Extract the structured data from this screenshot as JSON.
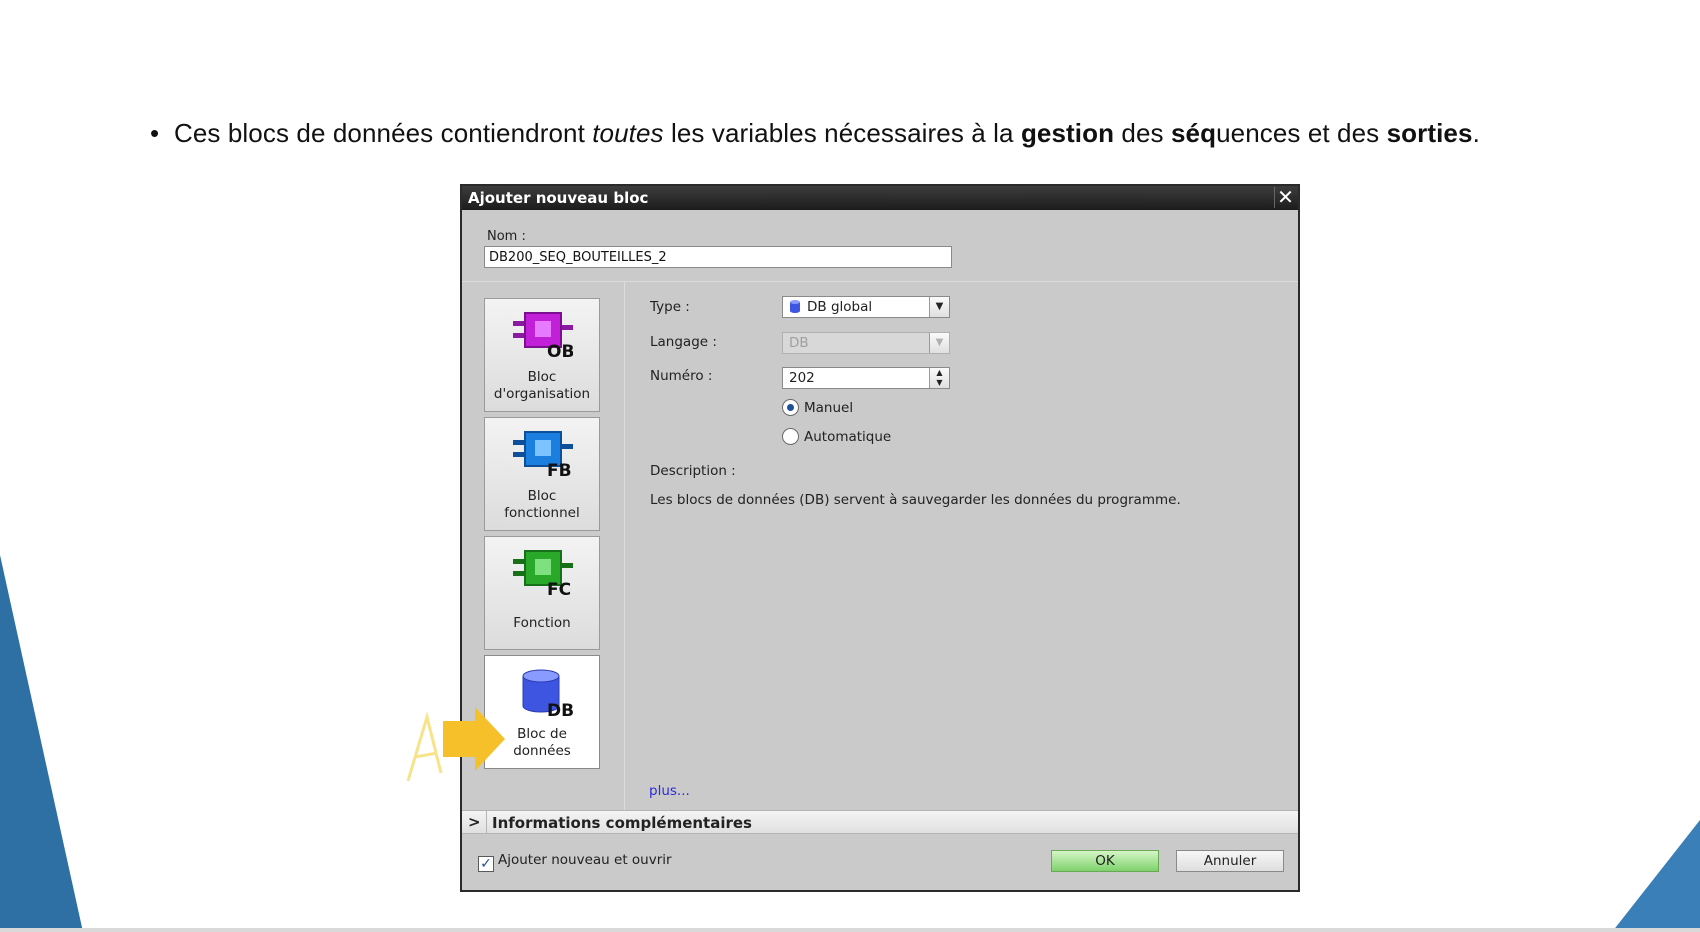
{
  "slide": {
    "bullet": {
      "part1": "Ces blocs de données contiendront ",
      "emph": "toutes",
      "part2": " les variables nécessaires à la ",
      "bold1": "gestion",
      "part3": " des ",
      "bold2": "séq",
      "part4": "uences et des ",
      "bold3": "sorties",
      "part5": "."
    }
  },
  "dialog": {
    "title": "Ajouter nouveau bloc",
    "close_icon": "✕",
    "name_label": "Nom :",
    "name_value": "DB200_SEQ_BOUTEILLES_2",
    "blocks": [
      {
        "line1": "Bloc",
        "line2": "d'organisation",
        "badge": "OB",
        "color": "#c21fd9"
      },
      {
        "line1": "Bloc",
        "line2": "fonctionnel",
        "badge": "FB",
        "color": "#1b7fe0"
      },
      {
        "line1": "Fonction",
        "badge": "FC",
        "color": "#2aa82a"
      },
      {
        "line1": "Bloc de",
        "line2": "données",
        "badge": "DB",
        "color": "#3d55e0"
      }
    ],
    "type_label": "Type :",
    "type_value": "DB global",
    "language_label": "Langage :",
    "language_value": "DB",
    "number_label": "Numéro :",
    "number_value": "202",
    "radio_manual": "Manuel",
    "radio_auto": "Automatique",
    "description_label": "Description :",
    "description_text": "Les blocs de données (DB) servent à sauvegarder les données du programme.",
    "more_link": "plus...",
    "info_bar": "Informations complémentaires",
    "checkbox_label": "Ajouter nouveau et ouvrir",
    "ok_label": "OK",
    "cancel_label": "Annuler"
  },
  "colors": {
    "slide_accent": "#2e6fa4",
    "pointer": "#f5c02a"
  }
}
